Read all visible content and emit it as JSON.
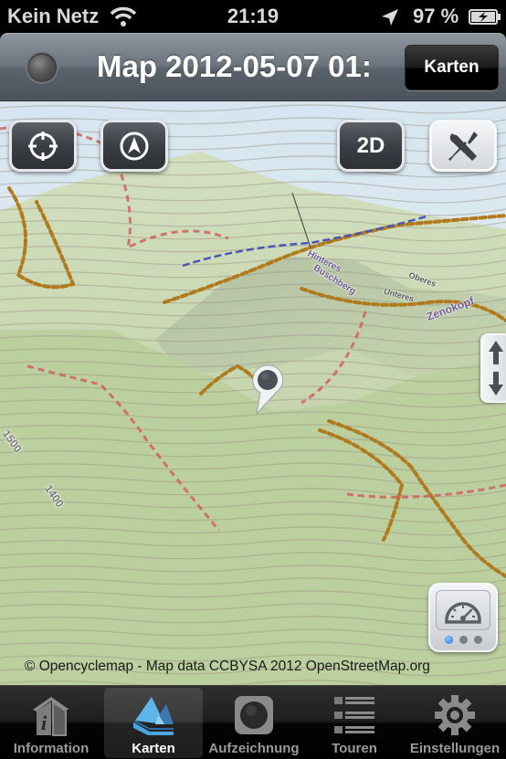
{
  "status_bar": {
    "carrier": "Kein Netz",
    "wifi_icon": "wifi-icon",
    "time": "21:19",
    "location_icon": "location-arrow-icon",
    "battery_percent": "97 %",
    "battery_icon": "battery-charging-icon"
  },
  "nav_bar": {
    "recording_indicator_icon": "record-led-icon",
    "title": "Map 2012-05-07 01:",
    "right_button_label": "Karten"
  },
  "map": {
    "controls": {
      "locate_icon": "crosshair-icon",
      "compass_icon": "compass-arrow-icon",
      "view_mode_label": "2D",
      "tools_icon": "wrench-screwdriver-icon",
      "tilt_icon": "up-down-arrows-icon",
      "dashboard_icon": "speedometer-icon",
      "dashboard_pages": 3,
      "dashboard_active_page": 1
    },
    "place_labels": [
      "Zenokopf",
      "Hinteres",
      "Buschberg",
      "Unteres",
      "Oberes"
    ],
    "contour_labels": [
      "1500",
      "1400"
    ],
    "pin_icon": "map-pin-icon",
    "attribution": "© Opencyclemap - Map data CCBYSA 2012 OpenStreetMap.org",
    "colors": {
      "sky": "#dbe8f0",
      "terrain": "#c1d2a5",
      "trail": "#b07a1e",
      "route": "#d06060",
      "contour": "#9b8f7f"
    }
  },
  "tab_bar": {
    "active_index": 1,
    "tabs": [
      {
        "label": "Information",
        "icon": "info-house-icon"
      },
      {
        "label": "Karten",
        "icon": "mountains-icon"
      },
      {
        "label": "Aufzeichnung",
        "icon": "record-button-icon"
      },
      {
        "label": "Touren",
        "icon": "list-icon"
      },
      {
        "label": "Einstellungen",
        "icon": "gear-icon"
      }
    ]
  }
}
